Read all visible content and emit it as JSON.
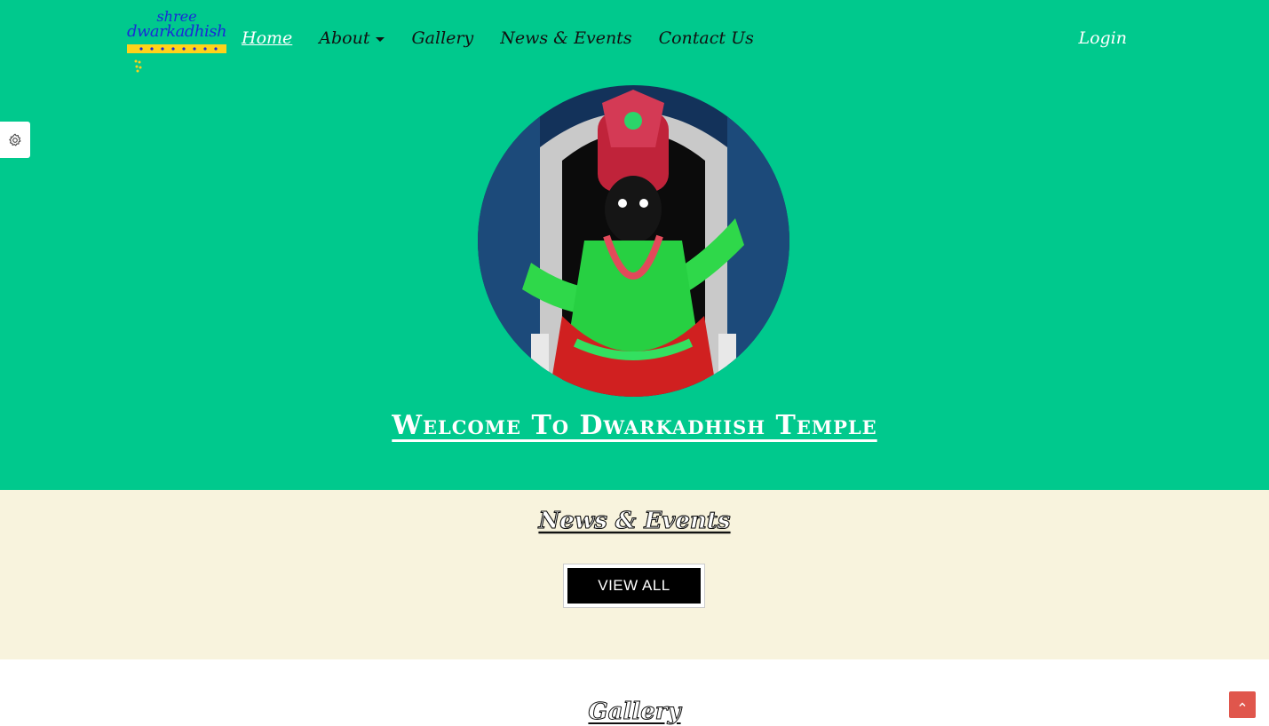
{
  "brand": {
    "line1": "shree",
    "line2": "dwarkadhish"
  },
  "nav": {
    "items": [
      {
        "label": "Home",
        "active": true
      },
      {
        "label": "About",
        "has_dropdown": true
      },
      {
        "label": "Gallery"
      },
      {
        "label": "News & Events"
      },
      {
        "label": "Contact Us"
      }
    ],
    "login": "Login"
  },
  "hero": {
    "welcome": "Welcome To Dwarkadhish Temple"
  },
  "news": {
    "title": "News & Events",
    "view_all": "VIEW ALL"
  },
  "gallery": {
    "title": "Gallery"
  },
  "icons": {
    "settings": "gear-icon",
    "scroll_top": "chevron-up-icon",
    "dropdown": "caret-down-icon"
  },
  "colors": {
    "hero_bg": "#00c98d",
    "news_bg": "#f8f3dd",
    "scroll_top_bg": "#e0564c",
    "brand_blue": "#1a2ad8"
  }
}
